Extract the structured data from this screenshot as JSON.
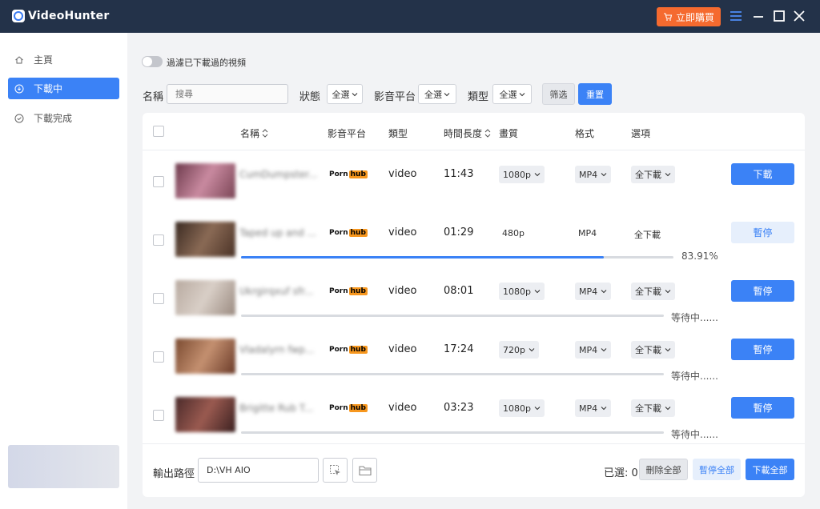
{
  "app": {
    "title": "VideoHunter",
    "buy_label": "立即購買"
  },
  "sidebar": {
    "items": [
      {
        "label": "主頁",
        "icon": "home-icon",
        "active": false
      },
      {
        "label": "下載中",
        "icon": "download-icon",
        "active": true
      },
      {
        "label": "下載完成",
        "icon": "check-circle-icon",
        "active": false
      }
    ]
  },
  "filters": {
    "toggle_label": "過濾已下載過的視頻",
    "name_label": "名稱",
    "search_placeholder": "搜尋",
    "status_label": "狀態",
    "status_value": "全選",
    "platform_label": "影音平台",
    "platform_value": "全選",
    "type_label": "類型",
    "type_value": "全選",
    "filter_btn": "筛选",
    "reset_btn": "重置"
  },
  "table": {
    "headers": {
      "name": "名稱",
      "platform": "影音平台",
      "type": "類型",
      "duration": "時間長度",
      "quality": "畫質",
      "format": "格式",
      "option": "選項"
    },
    "rows": [
      {
        "title": "CumDumpster...",
        "platform_a": "Porn",
        "platform_b": "hub",
        "type": "video",
        "duration": "11:43",
        "quality": "1080p",
        "format": "MP4",
        "option": "全下載",
        "action": "下載",
        "progress_text": "",
        "progress": null
      },
      {
        "title": "Taped up and ...",
        "platform_a": "Porn",
        "platform_b": "hub",
        "type": "video",
        "duration": "01:29",
        "quality": "480p",
        "format": "MP4",
        "option": "全下載",
        "action": "暫停",
        "progress_text": "83.91%",
        "progress": 0.8391
      },
      {
        "title": "Ukrgirqxuf sfr...",
        "platform_a": "Porn",
        "platform_b": "hub",
        "type": "video",
        "duration": "08:01",
        "quality": "1080p",
        "format": "MP4",
        "option": "全下載",
        "action": "暫停",
        "progress_text": "等待中......",
        "progress": 0
      },
      {
        "title": "Vladalyrn fwp...",
        "platform_a": "Porn",
        "platform_b": "hub",
        "type": "video",
        "duration": "17:24",
        "quality": "720p",
        "format": "MP4",
        "option": "全下載",
        "action": "暫停",
        "progress_text": "等待中......",
        "progress": 0
      },
      {
        "title": "Brigitte Rub T...",
        "platform_a": "Porn",
        "platform_b": "hub",
        "type": "video",
        "duration": "03:23",
        "quality": "1080p",
        "format": "MP4",
        "option": "全下載",
        "action": "暫停",
        "progress_text": "等待中......",
        "progress": 0
      }
    ]
  },
  "footer": {
    "output_label": "輸出路徑",
    "output_path": "D:\\VH AIO",
    "selected_label": "已選: 0",
    "delete_all": "刪除全部",
    "pause_all": "暫停全部",
    "download_all": "下載全部"
  },
  "colors": {
    "titlebar": "#233249",
    "accent": "#3b82f6",
    "buy": "#f56a2f",
    "hub": "#f7971e"
  }
}
